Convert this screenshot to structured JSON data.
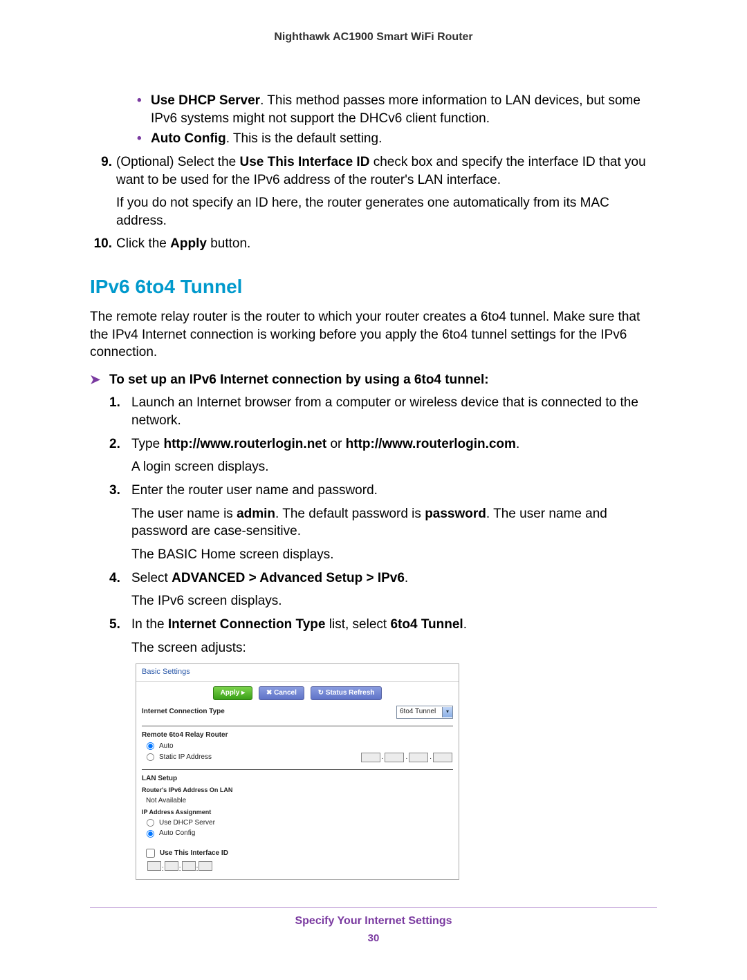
{
  "header": {
    "title": "Nighthawk AC1900 Smart WiFi Router"
  },
  "top_bullets": [
    {
      "strong": "Use DHCP Server",
      "rest": ". This method passes more information to LAN devices, but some IPv6 systems might not support the DHCv6 client function."
    },
    {
      "strong": "Auto Config",
      "rest": ". This is the default setting."
    }
  ],
  "step9": {
    "num": "9.",
    "line1_pre": "(Optional) Select the ",
    "line1_b": "Use This Interface ID",
    "line1_post": " check box and specify the interface ID that you want to be used for the IPv6 address of the router's LAN interface.",
    "line2": "If you do not specify an ID here, the router generates one automatically from its MAC address."
  },
  "step10": {
    "num": "10.",
    "pre": "Click the ",
    "b": "Apply",
    "post": " button."
  },
  "section_title": "IPv6 6to4 Tunnel",
  "section_intro": "The remote relay router is the router to which your router creates a 6to4 tunnel. Make sure that the IPv4 Internet connection is working before you apply the 6to4 tunnel settings for the IPv6 connection.",
  "proc_arrow": "➤",
  "proc_title": "To set up an IPv6 Internet connection by using a 6to4 tunnel:",
  "proc_steps": {
    "s1": {
      "num": "1.",
      "text": "Launch an Internet browser from a computer or wireless device that is connected to the network."
    },
    "s2": {
      "num": "2.",
      "pre": "Type ",
      "b1": "http://www.routerlogin.net",
      "mid": " or ",
      "b2": "http://www.routerlogin.com",
      "post": ".",
      "after": "A login screen displays."
    },
    "s3": {
      "num": "3.",
      "l1": "Enter the router user name and password.",
      "l2_pre": "The user name is ",
      "l2_b1": "admin",
      "l2_mid": ". The default password is ",
      "l2_b2": "password",
      "l2_post": ". The user name and password are case-sensitive.",
      "l3": "The BASIC Home screen displays."
    },
    "s4": {
      "num": "4.",
      "pre": "Select ",
      "b": "ADVANCED > Advanced Setup > IPv6",
      "post": ".",
      "after": "The IPv6 screen displays."
    },
    "s5": {
      "num": "5.",
      "pre": "In the ",
      "b1": "Internet Connection Type",
      "mid": " list, select ",
      "b2": "6to4 Tunnel",
      "post": ".",
      "after": "The screen adjusts:"
    }
  },
  "shot": {
    "title": "Basic Settings",
    "btn_apply": "Apply ▸",
    "btn_cancel": "✖ Cancel",
    "btn_refresh": "↻ Status Refresh",
    "conn_type_label": "Internet Connection Type",
    "conn_type_value": "6to4 Tunnel",
    "remote_relay": "Remote 6to4 Relay Router",
    "radio_auto": "Auto",
    "radio_static": "Static IP Address",
    "lan_setup": "LAN Setup",
    "router_ipv6": "Router's IPv6 Address On LAN",
    "not_available": "Not Available",
    "ip_assign": "IP Address Assignment",
    "use_dhcp": "Use DHCP Server",
    "auto_config": "Auto Config",
    "use_iface": "Use This Interface ID"
  },
  "footer": {
    "chapter": "Specify Your Internet Settings",
    "page": "30"
  }
}
